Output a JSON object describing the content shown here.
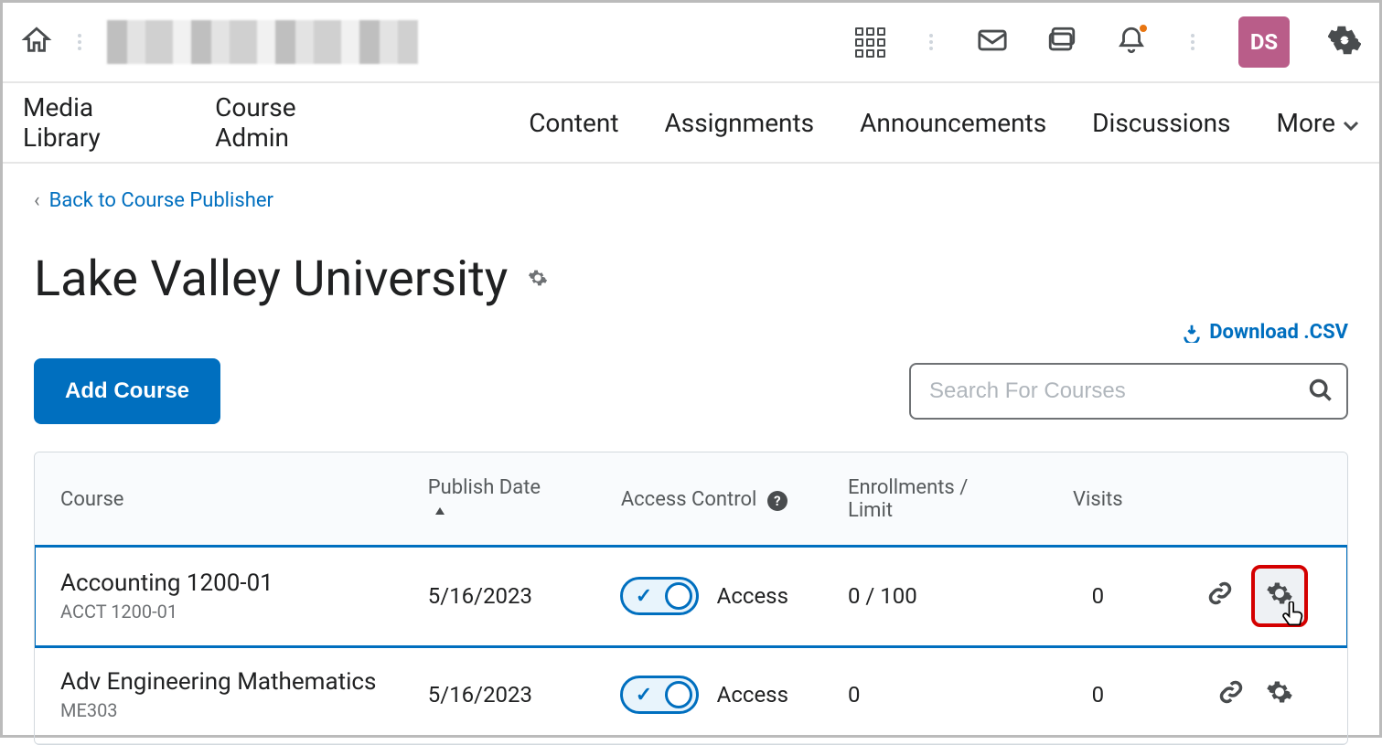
{
  "topbar": {
    "avatar_initials": "DS"
  },
  "nav": {
    "items": [
      "Media Library",
      "Course Admin",
      "Content",
      "Assignments",
      "Announcements",
      "Discussions"
    ],
    "more_label": "More"
  },
  "breadcrumb": {
    "caret": "‹",
    "back_label": "Back to Course Publisher"
  },
  "page": {
    "title": "Lake Valley University",
    "download_label": "Download .CSV",
    "add_button": "Add Course",
    "search_placeholder": "Search For Courses"
  },
  "table": {
    "headers": {
      "course": "Course",
      "publish": "Publish Date",
      "access": "Access Control",
      "enroll": "Enrollments / Limit",
      "visits": "Visits"
    },
    "rows": [
      {
        "name": "Accounting 1200-01",
        "code": "ACCT 1200-01",
        "publish_date": "5/16/2023",
        "access_label": "Access",
        "enroll": "0 / 100",
        "visits": "0"
      },
      {
        "name": "Adv Engineering Mathematics",
        "code": "ME303",
        "publish_date": "5/16/2023",
        "access_label": "Access",
        "enroll": "0",
        "visits": "0"
      }
    ]
  }
}
